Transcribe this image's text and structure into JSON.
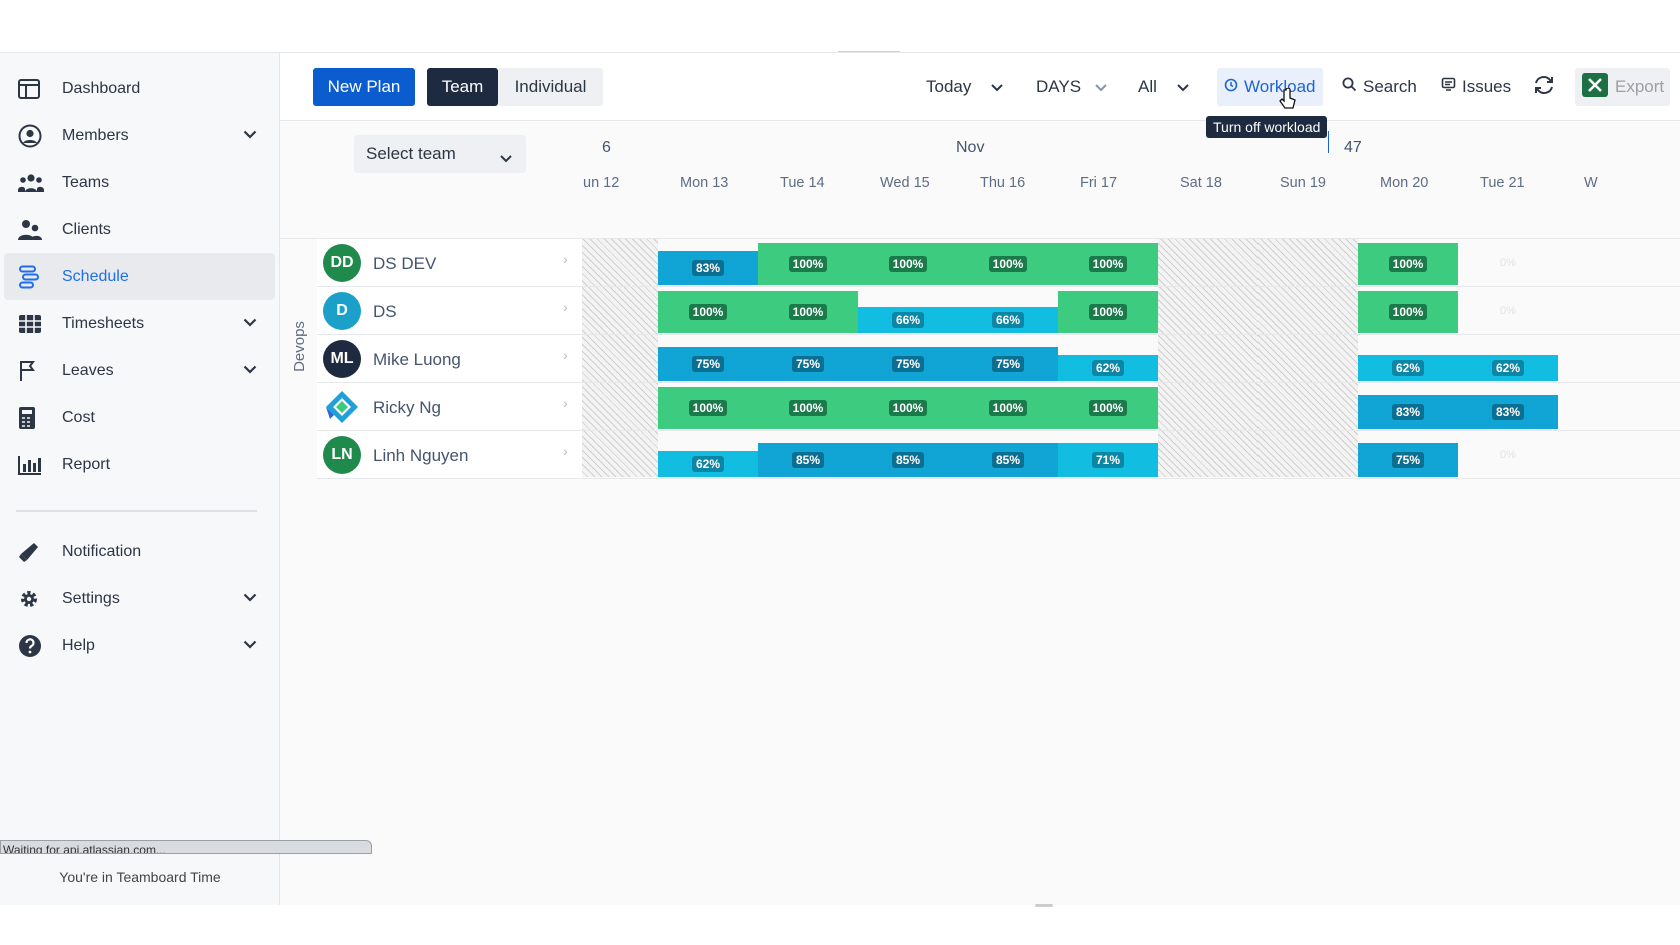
{
  "sidebar": {
    "items": [
      {
        "label": "Dashboard",
        "icon": "dashboard-icon",
        "expandable": false,
        "active": false
      },
      {
        "label": "Members",
        "icon": "user-circle-icon",
        "expandable": true,
        "active": false
      },
      {
        "label": "Teams",
        "icon": "people-group-icon",
        "expandable": false,
        "active": false
      },
      {
        "label": "Clients",
        "icon": "clients-icon",
        "expandable": false,
        "active": false
      },
      {
        "label": "Schedule",
        "icon": "schedule-icon",
        "expandable": false,
        "active": true
      },
      {
        "label": "Timesheets",
        "icon": "table-grid-icon",
        "expandable": true,
        "active": false
      },
      {
        "label": "Leaves",
        "icon": "flag-icon",
        "expandable": true,
        "active": false
      },
      {
        "label": "Cost",
        "icon": "calculator-icon",
        "expandable": false,
        "active": false
      },
      {
        "label": "Report",
        "icon": "bar-chart-icon",
        "expandable": false,
        "active": false
      }
    ],
    "bottom_items": [
      {
        "label": "Notification",
        "icon": "megaphone-icon",
        "expandable": false
      },
      {
        "label": "Settings",
        "icon": "gear-icon",
        "expandable": true
      },
      {
        "label": "Help",
        "icon": "help-circle-icon",
        "expandable": true
      }
    ],
    "footer_text": "You're in Teamboard Time",
    "status_text": "Waiting for api.atlassian.com..."
  },
  "toolbar": {
    "new_plan": "New Plan",
    "team": "Team",
    "individual": "Individual",
    "today": "Today",
    "days": "DAYS",
    "all": "All",
    "workload": "Workload",
    "search": "Search",
    "issues": "Issues",
    "export": "Export",
    "tooltip": "Turn off workload"
  },
  "header": {
    "select_team": "Select team",
    "month_left": "6",
    "month": "Nov",
    "week_num": "47",
    "days": [
      "un 12",
      "Mon 13",
      "Tue 14",
      "Wed 15",
      "Thu 16",
      "Fri 17",
      "Sat 18",
      "Sun 19",
      "Mon 20",
      "Tue 21",
      "W"
    ]
  },
  "group": {
    "label": "Devops"
  },
  "members": [
    {
      "name": "DS DEV",
      "initials": "DD",
      "avatar_color": "#1f8a4c",
      "cells": [
        null,
        "83%",
        "100%",
        "100%",
        "100%",
        "100%",
        null,
        null,
        "100%",
        "0%"
      ]
    },
    {
      "name": "DS",
      "initials": "D",
      "avatar_color": "#1ba1c9",
      "cells": [
        null,
        "100%",
        "100%",
        "66%",
        "66%",
        "100%",
        null,
        null,
        "100%",
        "0%"
      ]
    },
    {
      "name": "Mike Luong",
      "initials": "ML",
      "avatar_color": "#1d2a3f",
      "cells": [
        null,
        "75%",
        "75%",
        "75%",
        "75%",
        "62%",
        null,
        null,
        "62%",
        "62%"
      ]
    },
    {
      "name": "Ricky Ng",
      "initials": "",
      "avatar_color": "#ffffff",
      "cells": [
        null,
        "100%",
        "100%",
        "100%",
        "100%",
        "100%",
        null,
        null,
        "83%",
        "83%"
      ]
    },
    {
      "name": "Linh Nguyen",
      "initials": "LN",
      "avatar_color": "#1f8a4c",
      "cells": [
        null,
        "62%",
        "85%",
        "85%",
        "85%",
        "71%",
        null,
        null,
        "75%",
        "0%"
      ]
    }
  ],
  "colors": {
    "full": "#3ccb7f",
    "high": "#10a5d4",
    "mid": "#11bde0",
    "brand": "#0b5ccf"
  }
}
